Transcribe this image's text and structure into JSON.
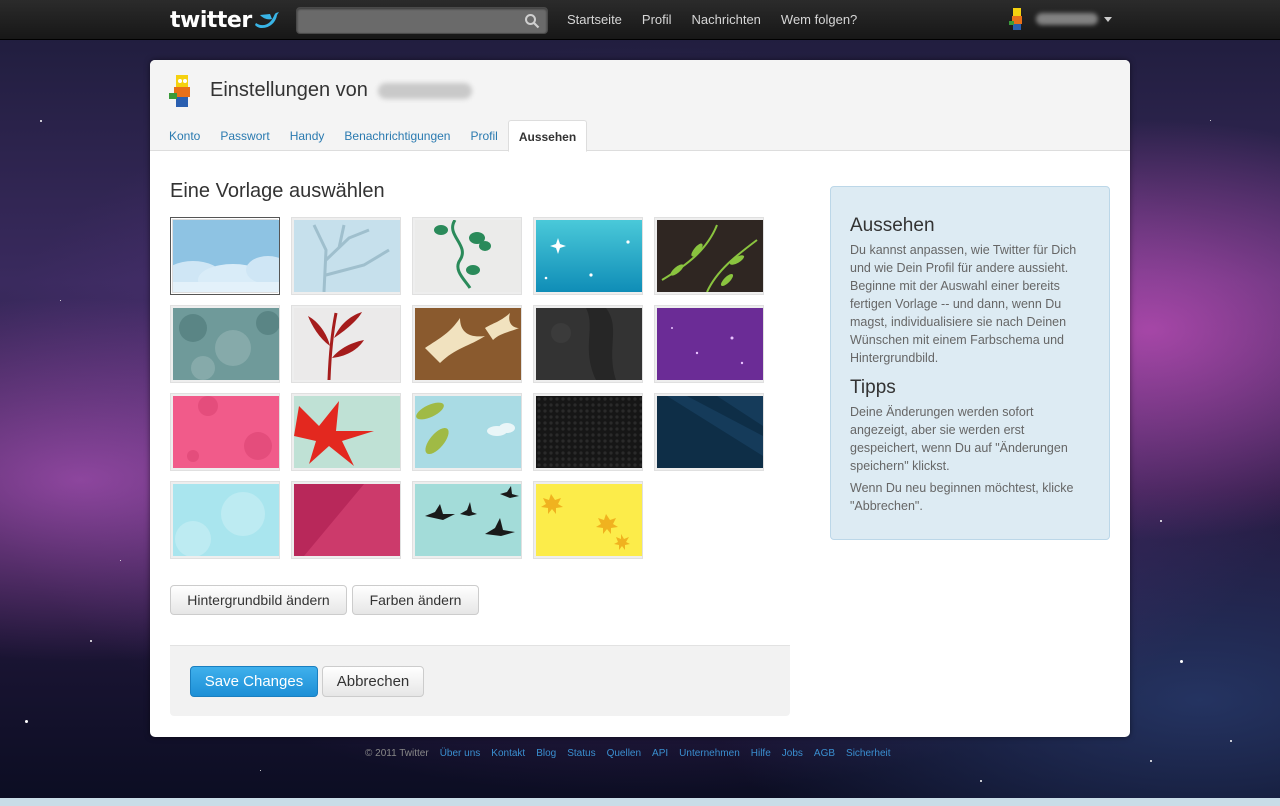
{
  "topbar": {
    "logo_text": "twitter",
    "search_placeholder": "",
    "nav": [
      "Startseite",
      "Profil",
      "Nachrichten",
      "Wem folgen?"
    ]
  },
  "page": {
    "title": "Einstellungen von",
    "tabs": [
      "Konto",
      "Passwort",
      "Handy",
      "Benachrichtigungen",
      "Profil",
      "Aussehen"
    ],
    "active_tab": "Aussehen",
    "section_title": "Eine Vorlage auswählen",
    "buttons": {
      "background": "Hintergrundbild ändern",
      "colors": "Farben ändern",
      "save": "Save Changes",
      "cancel": "Abbrechen"
    }
  },
  "themes": [
    {
      "name": "clouds",
      "selected": true
    },
    {
      "name": "branches"
    },
    {
      "name": "green-vine"
    },
    {
      "name": "sparkle-cyan"
    },
    {
      "name": "leaves-dark"
    },
    {
      "name": "trees-teal"
    },
    {
      "name": "red-plant"
    },
    {
      "name": "birds-brown"
    },
    {
      "name": "dark-grunge"
    },
    {
      "name": "purple-stars"
    },
    {
      "name": "pink-flowers"
    },
    {
      "name": "red-leaves"
    },
    {
      "name": "leaves-sky"
    },
    {
      "name": "hex-black"
    },
    {
      "name": "rays-navy"
    },
    {
      "name": "light-cyan"
    },
    {
      "name": "crimson-diagonal"
    },
    {
      "name": "black-birds"
    },
    {
      "name": "yellow-maple"
    }
  ],
  "sidebar": {
    "heading": "Aussehen",
    "text": "Du kannst anpassen, wie Twitter für Dich und wie Dein Profil für andere aussieht. Beginne mit der Auswahl einer bereits fertigen Vorlage -- und dann, wenn Du magst, individualisiere sie nach Deinen Wünschen mit einem Farbschema und Hintergrundbild.",
    "tips_heading": "Tipps",
    "tips_text": "Deine Änderungen werden sofort angezeigt, aber sie werden erst gespeichert, wenn Du auf \"Änderungen speichern\" klickst.",
    "tips_text2": "Wenn Du neu beginnen möchtest, klicke \"Abbrechen\"."
  },
  "footer": {
    "copyright": "© 2011 Twitter",
    "links": [
      "Über uns",
      "Kontakt",
      "Blog",
      "Status",
      "Quellen",
      "API",
      "Unternehmen",
      "Hilfe",
      "Jobs",
      "AGB",
      "Sicherheit"
    ]
  },
  "colors": {
    "accent": "#2a7ab0",
    "save_button": "#1d8fd6",
    "sidebar_bg": "#ddebf3"
  }
}
